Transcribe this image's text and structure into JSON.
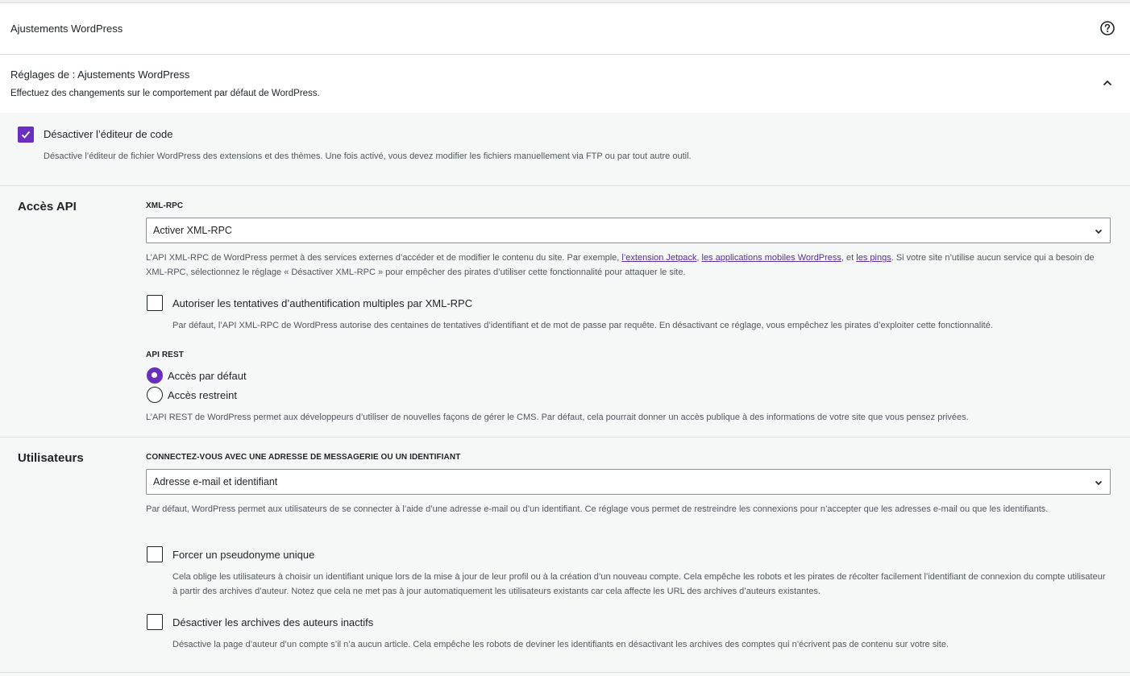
{
  "header": {
    "title": "Ajustements WordPress",
    "help_icon": "help-circle-icon"
  },
  "settings_panel": {
    "title": "Réglages de : Ajustements WordPress",
    "description": "Effectuez des changements sur le comportement par défaut de WordPress.",
    "collapse_icon": "chevron-up-icon"
  },
  "code_editor": {
    "label": "Désactiver l’éditeur de code",
    "checked": true,
    "description": "Désactive l’éditeur de fichier WordPress des extensions et des thèmes. Une fois activé, vous devez modifier les fichiers manuellement via FTP ou par tout autre outil."
  },
  "api": {
    "heading": "Accès API",
    "xmlrpc": {
      "label": "XML-RPC",
      "value": "Activer XML-RPC",
      "desc_before": "L’API XML-RPC de WordPress permet à des services externes d’accéder et de modifier le contenu du site. Par exemple, ",
      "link1": "l’extension Jetpack",
      "sep1": ", ",
      "link2": "les applications mobiles WordPress",
      "sep2": ", et ",
      "link3": "les pings",
      "desc_after": ". Si votre site n’utilise aucun service qui a besoin de XML-RPC, sélectionnez le réglage « Désactiver XML-RPC » pour empêcher des pirates d’utiliser cette fonctionnalité pour attaquer le site."
    },
    "multi_auth": {
      "label": "Autoriser les tentatives d’authentification multiples par XML-RPC",
      "checked": false,
      "description": "Par défaut, l’API XML-RPC de WordPress autorise des centaines de tentatives d’identifiant et de mot de passe par requête. En désactivant ce réglage, vous empêchez les pirates d’exploiter cette fonctionnalité."
    },
    "rest": {
      "label": "API REST",
      "option_default": "Accès par défaut",
      "option_restricted": "Accès restreint",
      "selected": "Accès par défaut",
      "description": "L’API REST de WordPress permet aux développeurs d’utiliser de nouvelles façons de gérer le CMS. Par défaut, cela pourrait donner un accès publique à des informations de votre site que vous pensez privées."
    }
  },
  "users": {
    "heading": "Utilisateurs",
    "login": {
      "label": "CONNECTEZ-VOUS AVEC UNE ADRESSE DE MESSAGERIE OU UN IDENTIFIANT",
      "value": "Adresse e-mail et identifiant",
      "description": "Par défaut, WordPress permet aux utilisateurs de se connecter à l’aide d’une adresse e-mail ou d’un identifiant. Ce réglage vous permet de restreindre les connexions pour n’accepter que les adresses e-mail ou que les identifiants."
    },
    "unique_nick": {
      "label": "Forcer un pseudonyme unique",
      "checked": false,
      "description": "Cela oblige les utilisateurs à choisir un identifiant unique lors de la mise à jour de leur profil ou à la création d’un nouveau compte. Cela empêche les robots et les pirates de récolter facilement l’identifiant de connexion du compte utilisateur à partir des archives d’auteur. Notez que cela ne met pas à jour automatiquement les utilisateurs existants car cela affecte les URL des archives d’auteurs existantes."
    },
    "inactive_archives": {
      "label": "Désactiver les archives des auteurs inactifs",
      "checked": false,
      "description": "Désactive la page d’auteur d’un compte s’il n’a aucun article. Cela empêche les robots de deviner les identifiants en désactivant les archives des comptes qui n’écrivent pas de contenu sur votre site."
    }
  },
  "colors": {
    "accent": "#6b2fbf",
    "link": "#5b2c9e",
    "text": "#1d2327",
    "muted": "#50575e"
  }
}
